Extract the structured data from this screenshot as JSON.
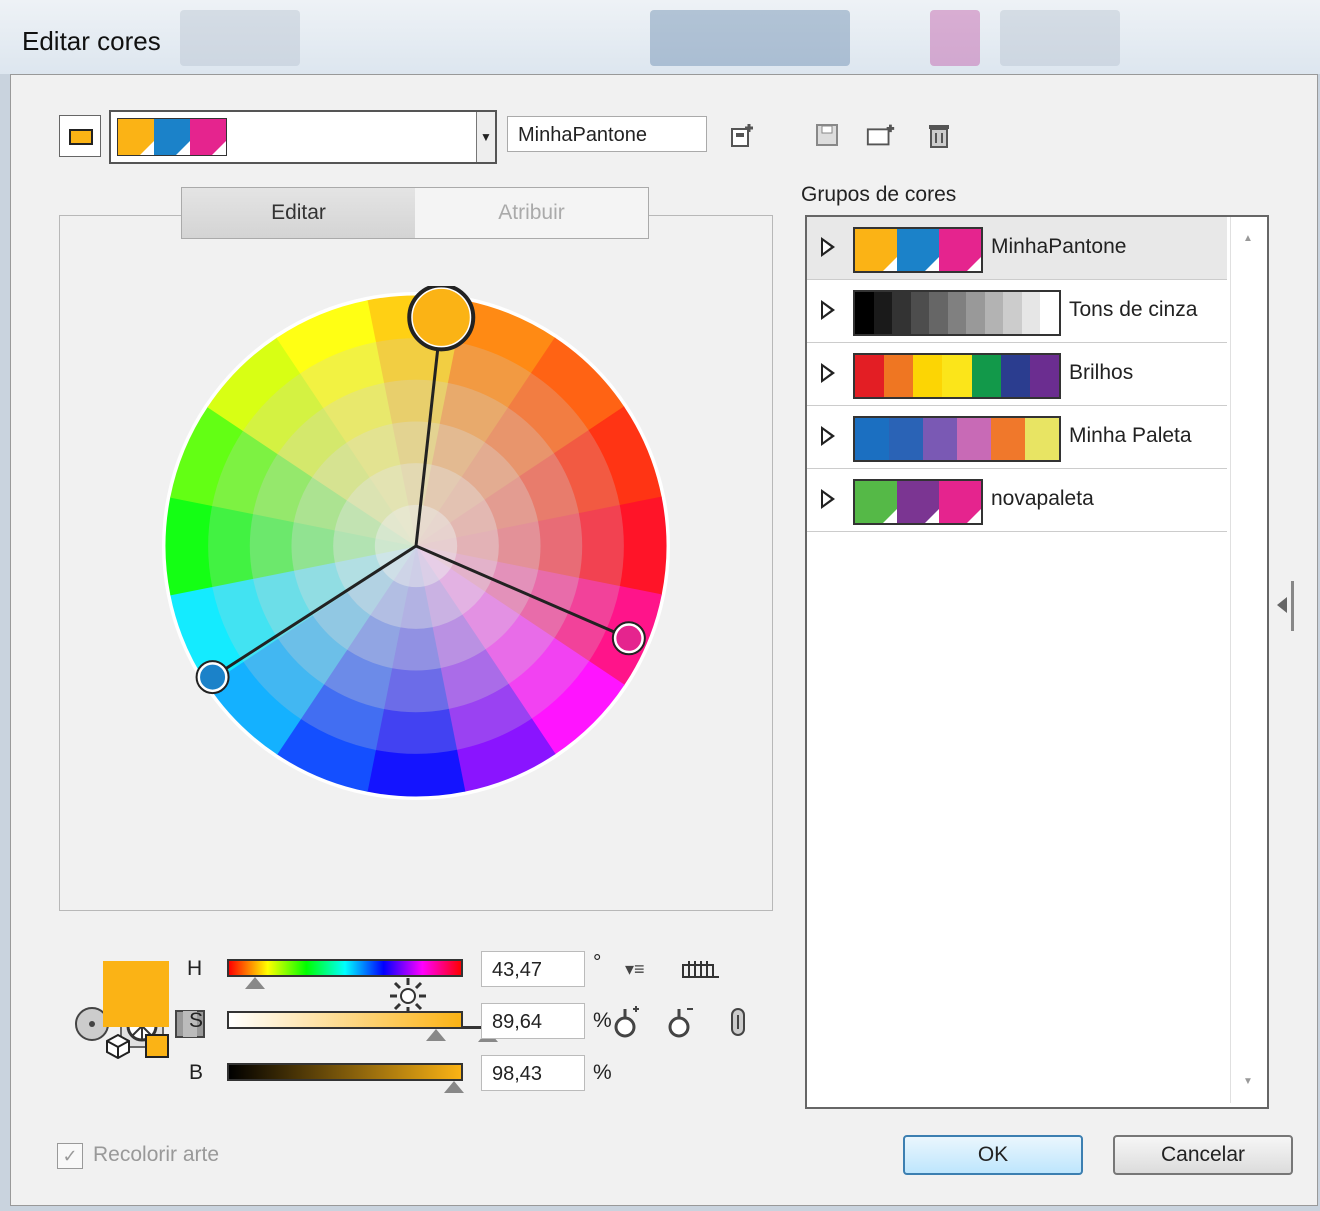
{
  "window": {
    "title": "Editar cores"
  },
  "toolbar": {
    "group_name_value": "MinhaPantone",
    "swatches": [
      "#fbb315",
      "#1b82c9",
      "#e5248e"
    ],
    "new_group_icon": "new-color-group-icon",
    "save_icon": "save-icon",
    "new_folder_icon": "new-folder-icon",
    "delete_icon": "trash-icon"
  },
  "tabs": [
    {
      "label": "Editar",
      "active": true
    },
    {
      "label": "Atribuir",
      "active": false
    }
  ],
  "wheel": {
    "base_hex": "#fbb315",
    "markers": [
      {
        "name": "base",
        "color": "#fbb315"
      },
      {
        "name": "secondary",
        "color": "#e5248e"
      },
      {
        "name": "tertiary",
        "color": "#1b82c9"
      }
    ],
    "brightness_icon": "sun-icon"
  },
  "groups": {
    "label": "Grupos de cores",
    "items": [
      {
        "name": "MinhaPantone",
        "colors": [
          "#fbb315",
          "#1b82c9",
          "#e5248e"
        ],
        "selected": true,
        "corner": true
      },
      {
        "name": "Tons de cinza",
        "colors": [
          "#000000",
          "#1a1a1a",
          "#333333",
          "#4d4d4d",
          "#666666",
          "#808080",
          "#999999",
          "#b3b3b3",
          "#cccccc",
          "#e6e6e6",
          "#ffffff"
        ],
        "selected": false
      },
      {
        "name": "Brilhos",
        "colors": [
          "#e31e24",
          "#ef7622",
          "#fcd504",
          "#fbe51a",
          "#12994a",
          "#2b3d8f",
          "#6b2d90"
        ],
        "selected": false
      },
      {
        "name": "Minha Paleta",
        "colors": [
          "#1b6fc1",
          "#2a63b6",
          "#7a59b4",
          "#c86ab6",
          "#f0782b",
          "#e8e463"
        ],
        "selected": false
      },
      {
        "name": "novapaleta",
        "colors": [
          "#55b947",
          "#7b3592",
          "#e5248e"
        ],
        "selected": false,
        "corner": true
      }
    ]
  },
  "hsb": {
    "h_label": "H",
    "h_value": "43,47",
    "h_unit": "°",
    "h_level": 0.12,
    "s_label": "S",
    "s_value": "89,64",
    "s_unit": "%",
    "s_level": 0.9,
    "b_label": "B",
    "b_value": "98,43",
    "b_unit": "%",
    "b_level": 0.98
  },
  "footer": {
    "recolor_label": "Recolorir arte",
    "ok_label": "OK",
    "cancel_label": "Cancelar"
  }
}
